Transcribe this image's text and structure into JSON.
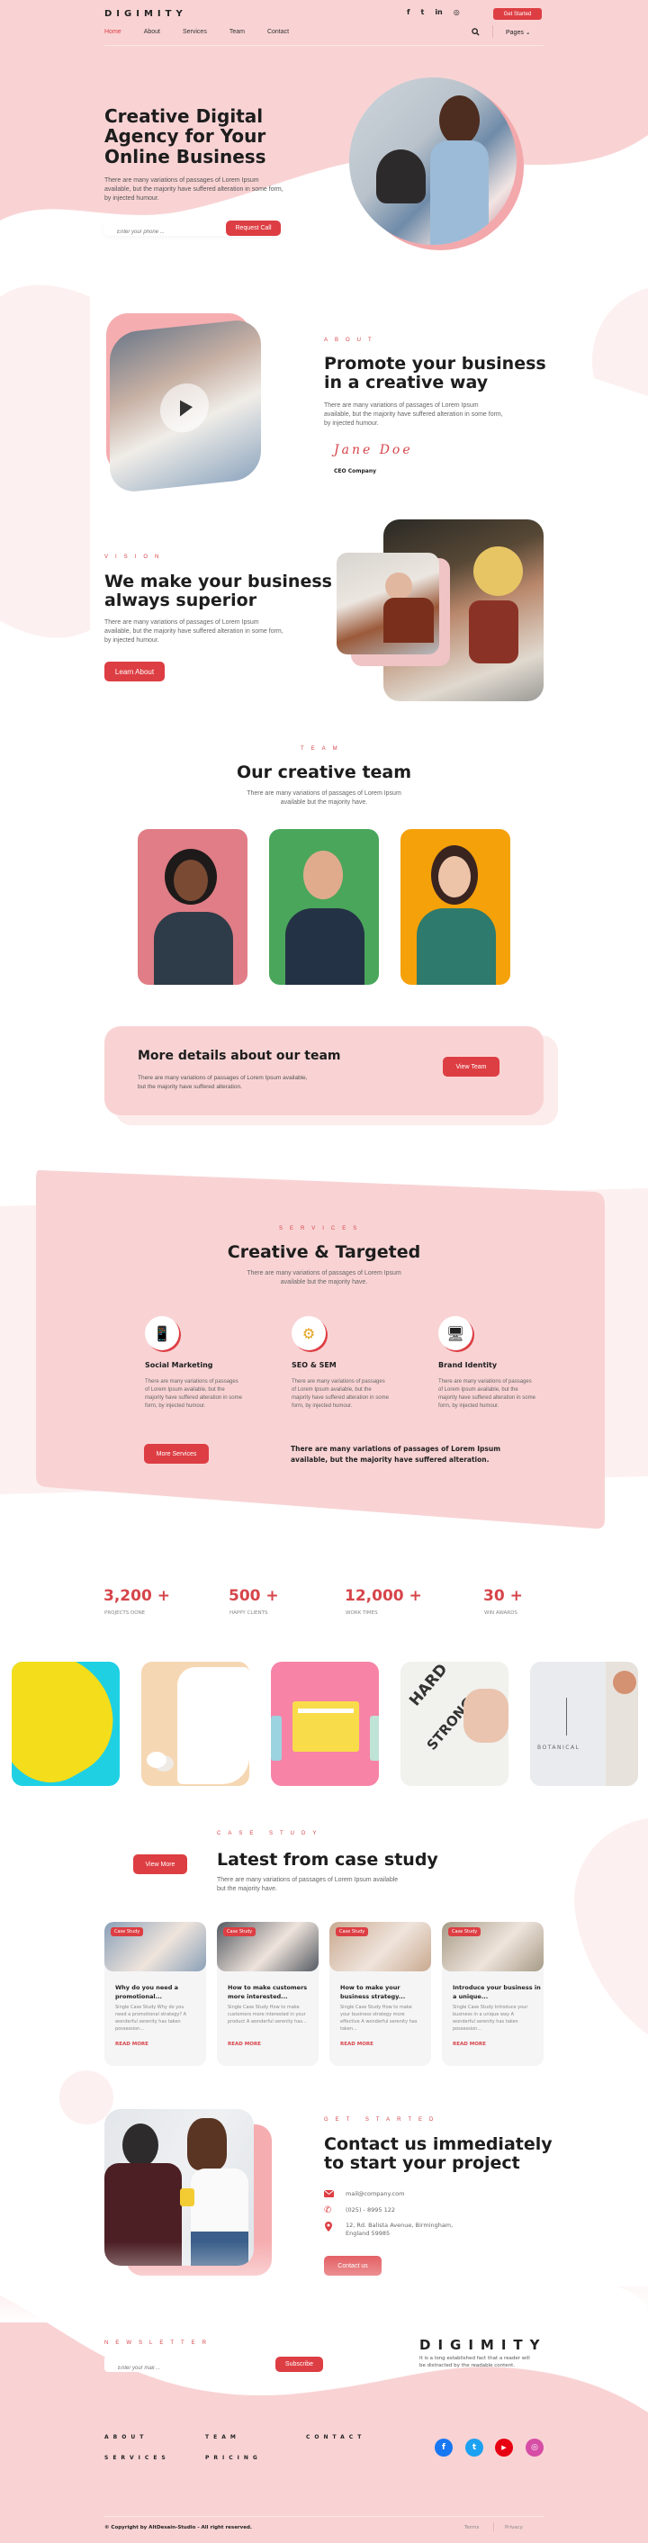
{
  "brand": "DIGIMITY",
  "header": {
    "social": [
      {
        "icon": "facebook-icon",
        "glyph": "f"
      },
      {
        "icon": "twitter-icon",
        "glyph": "t"
      },
      {
        "icon": "linkedin-icon",
        "glyph": "in"
      },
      {
        "icon": "instagram-icon",
        "glyph": "◎"
      }
    ],
    "cta": "Get Started",
    "nav": [
      "Home",
      "About",
      "Services",
      "Team",
      "Contact"
    ],
    "active": "Home",
    "search_icon": "🔍",
    "pages_label": "Pages ⌄"
  },
  "hero": {
    "title_lines": [
      "Creative Digital",
      "Agency for Your",
      "Online Business"
    ],
    "text": "There are many variations of passages of Lorem Ipsum available, but the majority have suffered alteration in some form, by injected humour.",
    "phone_placeholder": "Enter your phone ...",
    "button": "Request Call"
  },
  "about": {
    "eyebrow": "ABOUT",
    "title_lines": [
      "Promote your business",
      "in a creative way"
    ],
    "text": "There are many variations of passages of Lorem Ipsum available, but the majority have suffered alteration in some form, by injected humour.",
    "signature": "Jane Doe",
    "role": "CEO Company"
  },
  "vision": {
    "eyebrow": "VISION",
    "title_lines": [
      "We make your business",
      "always superior"
    ],
    "text": "There are many variations of passages of Lorem Ipsum available, but the majority have suffered alteration in some form, by injected humour.",
    "button": "Learn About"
  },
  "team": {
    "eyebrow": "TEAM",
    "title": "Our creative team",
    "text_lines": [
      "There are many variations of passages of Lorem Ipsum",
      "available but the majority have."
    ],
    "members": [
      {
        "bg": "#e07d86"
      },
      {
        "bg": "#4aa65b"
      },
      {
        "bg": "#f5a10a"
      }
    ]
  },
  "team_cta": {
    "title": "More details about our team",
    "text_lines": [
      "There are many variations of passages of Lorem Ipsum available,",
      "but the majority have suffered alteration."
    ],
    "button": "View Team"
  },
  "services": {
    "eyebrow": "SERVICES",
    "title": "Creative & Targeted",
    "text_lines": [
      "There are many variations of passages of Lorem Ipsum",
      "available but the majority have."
    ],
    "items": [
      {
        "title": "Social Marketing",
        "icon": "social-marketing-icon",
        "glyph": "📱",
        "text": "There are many variations of passages of Lorem Ipsum available, but the majority have suffered alteration in some form, by injected humour."
      },
      {
        "title": "SEO & SEM",
        "icon": "seo-icon",
        "glyph": "⚙",
        "text": "There are many variations of passages of Lorem Ipsum available, but the majority have suffered alteration in some form, by injected humour."
      },
      {
        "title": "Brand Identity",
        "icon": "brand-identity-icon",
        "glyph": "🖥",
        "text": "There are many variations of passages of Lorem Ipsum available, but the majority have suffered alteration in some form, by injected humour."
      }
    ],
    "button": "More Services",
    "note": "There are many variations of passages of Lorem Ipsum available, but the majority have suffered alteration."
  },
  "stats": [
    {
      "value": "3,200 +",
      "label": "PROJECTS DONE"
    },
    {
      "value": "500 +",
      "label": "HAPPY CLIENTS"
    },
    {
      "value": "12,000 +",
      "label": "WORK TIMES"
    },
    {
      "value": "30 +",
      "label": "WIN AWARDS"
    }
  ],
  "gallery": [
    {
      "name": "yellow-cap",
      "bg": "#1fd0e3",
      "fg": "#f4dd1a"
    },
    {
      "name": "white-onesie",
      "bg": "#f6d7b3",
      "fg": "#ffffff"
    },
    {
      "name": "yellow-folder",
      "bg": "#f783a6",
      "fg": "#f8dc4a"
    },
    {
      "name": "lettering",
      "bg": "#f1f1ee",
      "fg": "#333333"
    },
    {
      "name": "botanical-card",
      "bg": "#dcdcdc",
      "fg": "#eeeeee"
    }
  ],
  "case_study": {
    "eyebrow": "CASE STUDY",
    "button": "View More",
    "title": "Latest from case study",
    "text_lines": [
      "There are many variations of passages of Lorem Ipsum available",
      "but the majority have."
    ],
    "tag": "Case Study",
    "read_more": "READ MORE",
    "cards": [
      {
        "title_lines": [
          "Why do you need a",
          "promotional..."
        ],
        "text": "Single Case Study Why do you need a promotional strategy? A wonderful serenity has taken possession...",
        "img": "#8aa0b8"
      },
      {
        "title_lines": [
          "How to make customers",
          "more interested..."
        ],
        "text": "Single Case Study How to make customers more interested in your product A wonderful serenity has...",
        "img": "#545a62"
      },
      {
        "title_lines": [
          "How to make your",
          "business strategy..."
        ],
        "text": "Single Case Study How to make your business strategy more effective A wonderful serenity has taken...",
        "img": "#c9a98f"
      },
      {
        "title_lines": [
          "Introduce your business in",
          "a unique..."
        ],
        "text": "Single Case Study Introduce your business in a unique way A wonderful serenity has taken possession...",
        "img": "#a69b86"
      }
    ]
  },
  "contact": {
    "eyebrow": "GET STARTED",
    "title_lines": [
      "Contact us immediately",
      "to start your project"
    ],
    "email": "mail@company.com",
    "phone": "(025) - 8995 122",
    "address_lines": [
      "12, Rd. Balista Avenue, Birmingham,",
      "England 59985"
    ],
    "button": "Contact us"
  },
  "newsletter": {
    "eyebrow": "NEWSLETTER",
    "placeholder": "Enter your mail ...",
    "button": "Subscribe",
    "brand_text_lines": [
      "It is a long established fact that a reader will",
      "be distracted by the readable content."
    ]
  },
  "footer": {
    "links": [
      "ABOUT",
      "TEAM",
      "CONTACT",
      "SERVICES",
      "PRICING"
    ],
    "social": [
      {
        "icon": "facebook-icon",
        "glyph": "f",
        "color": "#1877f2"
      },
      {
        "icon": "twitter-icon",
        "glyph": "t",
        "color": "#1da1f2"
      },
      {
        "icon": "youtube-icon",
        "glyph": "▶",
        "color": "#e70012"
      },
      {
        "icon": "instagram-icon",
        "glyph": "◎",
        "color": "#d64da6"
      }
    ],
    "copyright": "© Copyright by AltDesain-Studio - All right reserved.",
    "terms": "Terms",
    "privacy": "Privacy"
  }
}
